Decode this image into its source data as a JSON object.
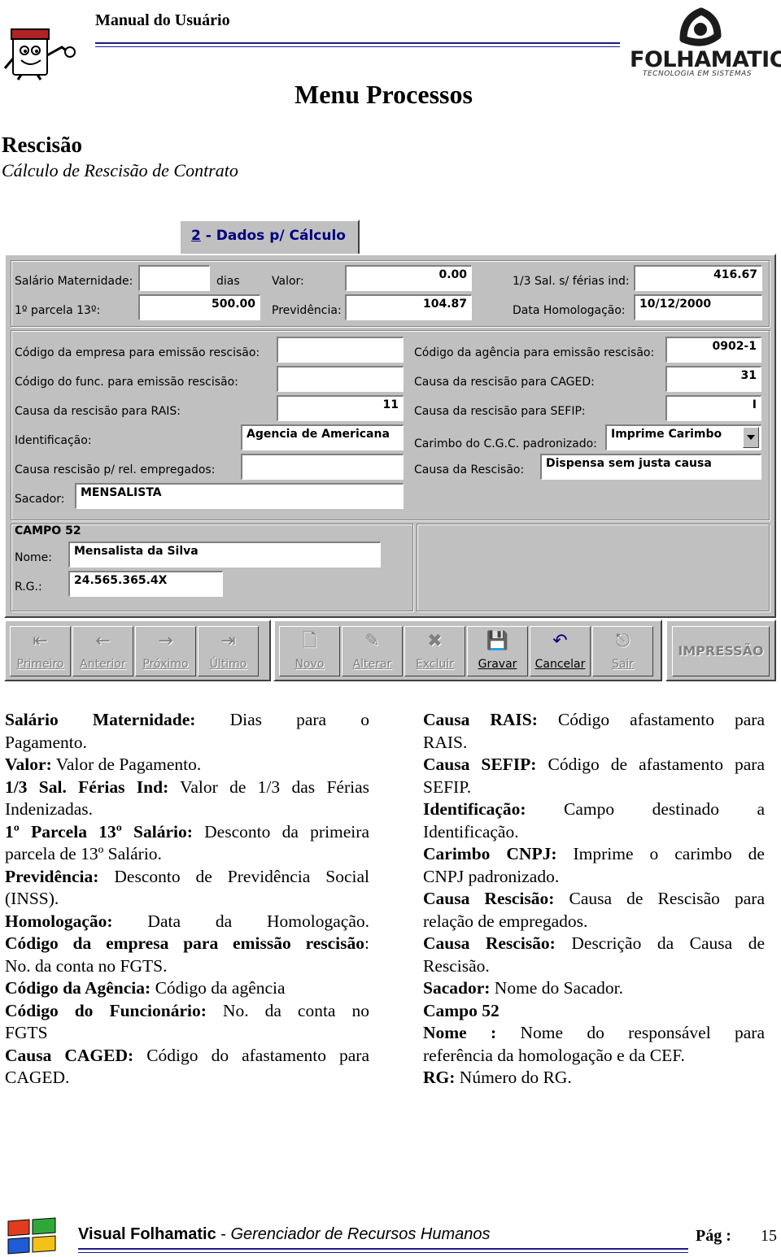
{
  "header": {
    "doc_title": "Manual do Usuário",
    "logo_text": "FOLHAMATIC",
    "logo_subtitle": "TECNOLOGIA EM SISTEMAS",
    "menu_title": "Menu Processos",
    "section_title": "Rescisão",
    "section_subtitle": "Cálculo de Rescisão de Contrato"
  },
  "screenshot": {
    "tab_number": "2",
    "tab_rest": " - Dados p/ Cálculo",
    "top": {
      "salario_maternidade_label": "Salário Maternidade:",
      "salario_maternidade_value": "",
      "dias_label": "dias",
      "valor_label": "Valor:",
      "valor_value": "0.00",
      "sal_ferias_label": "1/3 Sal. s/ férias ind:",
      "sal_ferias_value": "416.67",
      "parcela_label": "1º parcela 13º:",
      "parcela_value": "500.00",
      "previdencia_label": "Previdência:",
      "previdencia_value": "104.87",
      "homologacao_label": "Data Homologação:",
      "homologacao_value": "10/12/2000"
    },
    "middle": {
      "cod_empresa_label": "Código da empresa para emissão rescisão:",
      "cod_empresa_value": "",
      "cod_func_label": "Código do func. para emissão rescisão:",
      "cod_func_value": "",
      "causa_rais_label": "Causa da rescisão para RAIS:",
      "causa_rais_value": "11",
      "identificacao_label": "Identificação:",
      "identificacao_value": "Agencia de Americana",
      "causa_empregados_label": "Causa rescisão p/ rel. empregados:",
      "causa_empregados_value": "",
      "sacador_label": "Sacador:",
      "sacador_value": "MENSALISTA",
      "cod_agencia_label": "Código da agência para emissão rescisão:",
      "cod_agencia_value": "0902-1",
      "causa_caged_label": "Causa da rescisão para CAGED:",
      "causa_caged_value": "31",
      "causa_sefip_label": "Causa da rescisão para SEFIP:",
      "causa_sefip_value": "I",
      "carimbo_label": "Carimbo do C.G.C. padronizado:",
      "carimbo_value": "Imprime Carimbo",
      "causa_rescisao_label": "Causa da Rescisão:",
      "causa_rescisao_value": "Dispensa sem justa causa"
    },
    "campo52": {
      "title": "CAMPO 52",
      "nome_label": "Nome:",
      "nome_value": "Mensalista da Silva",
      "rg_label": "R.G.:",
      "rg_value": "24.565.365.4X"
    },
    "toolbar": {
      "primeiro": "Primeiro",
      "anterior": "Anterior",
      "proximo": "Próximo",
      "ultimo": "Último",
      "novo": "Novo",
      "alterar": "Alterar",
      "excluir": "Excluir",
      "gravar": "Gravar",
      "cancelar": "Cancelar",
      "sair": "Sair",
      "impressao": "IMPRESSÃO"
    }
  },
  "left_col": {
    "sm_b": "Salário Maternidade:",
    "sm_t1": "Dias para o",
    "sm_t2": "Pagamento.",
    "valor_b": "Valor:",
    "valor_t": " Valor de Pagamento.",
    "sal_b": "1/3 Sal. Férias Ind:",
    "sal_t1": " Valor de 1/3 das Férias",
    "sal_t2": "Indenizadas.",
    "parc_b": "1º Parcela 13º Salário:",
    "parc_t1": " Desconto da primeira",
    "parc_t2": "parcela de 13º Salário.",
    "prev_b": "Previdência:",
    "prev_t1": " Desconto de Previdência Social",
    "prev_t2": "(INSS).",
    "hom_b": "Homologação:",
    "hom_t": " Data da Homologação.",
    "emp_b": "Código da empresa para emissão rescisão",
    "emp_t1": ":",
    "emp_t2": "No. da conta no FGTS.",
    "ag_b": "Código da Agência:",
    "ag_t": " Código da agência",
    "func_b": "Código do Funcionário:",
    "func_t1": " No. da conta no",
    "func_t2": "FGTS",
    "caged_b": "Causa CAGED:",
    "caged_t1": " Código do afastamento para",
    "caged_t2": "CAGED."
  },
  "right_col": {
    "rais_b": "Causa RAIS:",
    "rais_t1": " Código afastamento para",
    "rais_t2": "RAIS.",
    "sefip_b": "Causa SEFIP:",
    "sefip_t1": " Código de afastamento para",
    "sefip_t2": "SEFIP.",
    "ident_b": "Identificação:",
    "ident_t1": " Campo destinado a",
    "ident_t2": "Identificação.",
    "carimbo_b": "Carimbo CNPJ:",
    "carimbo_t1": " Imprime o carimbo de",
    "carimbo_t2": "CNPJ padronizado.",
    "cr1_b": "Causa Rescisão:",
    "cr1_t1": " Causa de Rescisão para",
    "cr1_t2": "relação de empregados.",
    "cr2_b": "Causa Rescisão:",
    "cr2_t1": " Descrição da Causa de",
    "cr2_t2": "Rescisão.",
    "sac_b": "Sacador:",
    "sac_t": " Nome do Sacador.",
    "campo_b": "Campo 52",
    "nome_b": "Nome :",
    "nome_t1": " Nome do responsável para",
    "nome_t2": "referência da homologação e da CEF.",
    "rg_b": "RG:",
    "rg_t": " Número do RG."
  },
  "footer": {
    "brand": "Visual Folhamatic",
    "sep": " - ",
    "subtitle": "Gerenciador de Recursos Humanos",
    "page_label": "Pág :",
    "page_number": "15"
  }
}
